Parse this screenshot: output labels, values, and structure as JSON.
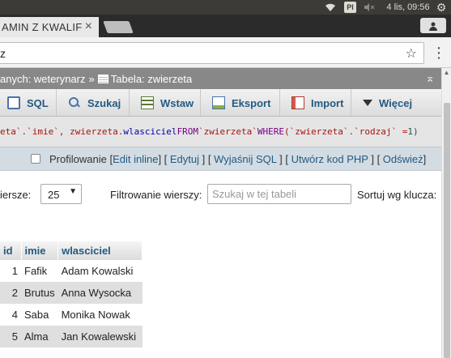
{
  "os": {
    "keyboard_layout": "Pl",
    "clock": "4 lis, 09:56",
    "icons": [
      "wifi-icon",
      "keyboard-layout-indicator",
      "volume-muted-icon",
      "settings-gear-icon"
    ]
  },
  "browser": {
    "tab_title": "AMIN Z KWALIF",
    "tab_close": "×",
    "url_visible": "z",
    "star": "☆",
    "menu": "⋮",
    "profile_icon": "profile-icon"
  },
  "breadcrumb": {
    "database": "anych: weterynarz",
    "separator": "»",
    "table": "Tabela: zwierzeta",
    "collapse": "⌅"
  },
  "menubar": {
    "items": [
      {
        "label": "SQL",
        "icon": "sql-icon"
      },
      {
        "label": "Szukaj",
        "icon": "search-icon"
      },
      {
        "label": "Wstaw",
        "icon": "insert-icon"
      },
      {
        "label": "Eksport",
        "icon": "export-icon"
      },
      {
        "label": "Import",
        "icon": "import-icon"
      },
      {
        "label": "Więcej",
        "icon": "chevron-down-icon"
      }
    ]
  },
  "query": {
    "p1": "eta`.`imie`, zwierzeta.",
    "p2": "wlasciciel",
    "p3": " FROM ",
    "p4": "`zwierzeta`",
    "p5": " WHERE ",
    "p6": "(`zwierzeta`.`rodzaj` =",
    "p7": "1",
    "p8": ")"
  },
  "tools": {
    "profiling": "Profilowanie",
    "edit_inline": "Edit inline",
    "edit": "Edytuj",
    "explain": "Wyjaśnij SQL",
    "php_code": "Utwórz kod PHP",
    "refresh": "Odśwież"
  },
  "filters": {
    "rows_label": "iersze:",
    "rows_value": "25",
    "filter_label": "Filtrowanie wierszy:",
    "filter_placeholder": "Szukaj w tej tabeli",
    "sort_label": "Sortuj wg klucza:"
  },
  "table": {
    "columns": [
      "id",
      "imie",
      "wlasciciel"
    ],
    "rows": [
      [
        "1",
        "Fafik",
        "Adam Kowalski"
      ],
      [
        "2",
        "Brutus",
        "Anna Wysocka"
      ],
      [
        "4",
        "Saba",
        "Monika Nowak"
      ],
      [
        "5",
        "Alma",
        "Jan Kowalewski"
      ]
    ]
  }
}
